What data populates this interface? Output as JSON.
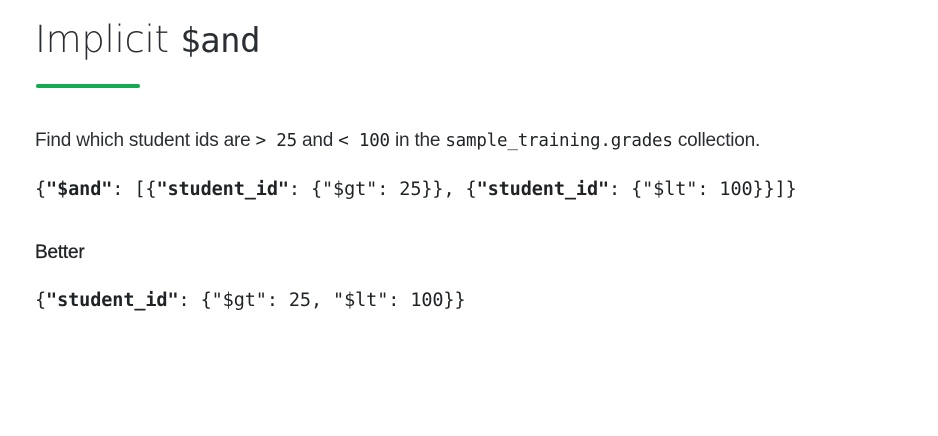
{
  "title": {
    "text": "Implicit ",
    "code": "$and"
  },
  "prompt": {
    "t1": "Find which student ids are ",
    "c1": "> 25",
    "t2": " and ",
    "c2": "< 100",
    "t3": " in the ",
    "c3": "sample_training.grades",
    "t4": " collection."
  },
  "query_explicit": {
    "p1": "{",
    "k1": "\"$and\"",
    "p2": ": [{",
    "k2": "\"student_id\"",
    "p3": ": {\"$gt\": 25}}, {",
    "k3": "\"student_id\"",
    "p4": ": {\"$lt\": 100}}]}"
  },
  "better_heading": "Better",
  "query_implicit": {
    "p1": "{",
    "k1": "\"student_id\"",
    "p2": ": {\"$gt\": 25, \"$lt\": 100}}"
  },
  "colors": {
    "accent": "#13aa52",
    "text": "#21272b"
  }
}
